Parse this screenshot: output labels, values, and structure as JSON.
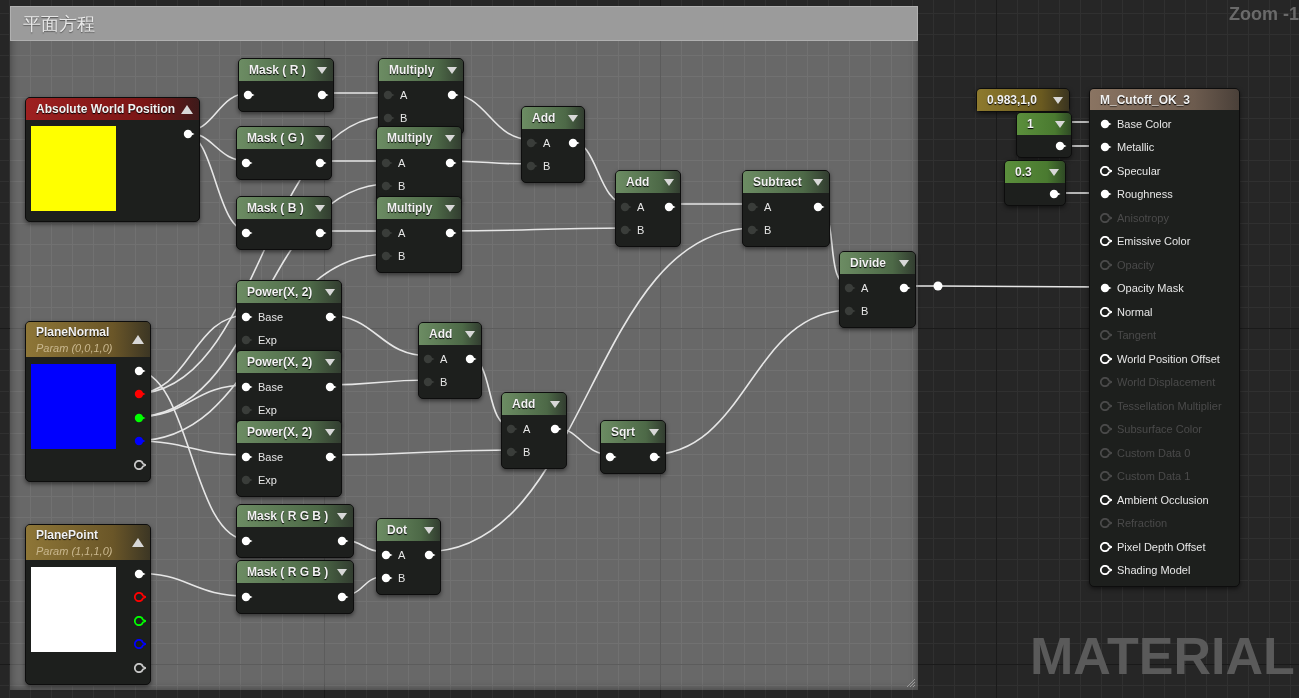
{
  "comment_box": {
    "title": "平面方程"
  },
  "zoom_label": "Zoom -1",
  "graph_type_label": "MATERIAL",
  "nodes": [
    {
      "kind": "input",
      "title": "Absolute World Position",
      "color": "#ffff00",
      "rows": [
        {
          "out": {
            "connected": true
          }
        }
      ]
    },
    {
      "kind": "expression",
      "title": "Mask ( R )",
      "rows": [
        {
          "in": {
            "connected": true
          },
          "out": {
            "connected": true
          }
        }
      ]
    },
    {
      "kind": "expression",
      "title": "Mask ( G )",
      "rows": [
        {
          "in": {
            "connected": true
          },
          "out": {
            "connected": true
          }
        }
      ]
    },
    {
      "kind": "expression",
      "title": "Mask ( B )",
      "rows": [
        {
          "in": {
            "connected": true
          },
          "out": {
            "connected": true
          }
        }
      ]
    },
    {
      "kind": "expression",
      "title": "Multiply",
      "rows": [
        {
          "in": {
            "label": "A",
            "connected": false
          },
          "out": {
            "connected": true
          }
        },
        {
          "in": {
            "label": "B",
            "connected": false
          }
        }
      ]
    },
    {
      "kind": "expression",
      "title": "Multiply",
      "rows": [
        {
          "in": {
            "label": "A",
            "connected": false
          },
          "out": {
            "connected": true
          }
        },
        {
          "in": {
            "label": "B",
            "connected": false
          }
        }
      ]
    },
    {
      "kind": "expression",
      "title": "Multiply",
      "rows": [
        {
          "in": {
            "label": "A",
            "connected": false
          },
          "out": {
            "connected": true
          }
        },
        {
          "in": {
            "label": "B",
            "connected": false
          }
        }
      ]
    },
    {
      "kind": "expression",
      "title": "Add",
      "rows": [
        {
          "in": {
            "label": "A",
            "connected": false
          },
          "out": {
            "connected": true
          }
        },
        {
          "in": {
            "label": "B",
            "connected": false
          }
        }
      ]
    },
    {
      "kind": "expression",
      "title": "Add",
      "rows": [
        {
          "in": {
            "label": "A",
            "connected": false
          },
          "out": {
            "connected": true
          }
        },
        {
          "in": {
            "label": "B",
            "connected": false
          }
        }
      ]
    },
    {
      "kind": "expression",
      "title": "Subtract",
      "rows": [
        {
          "in": {
            "label": "A",
            "connected": false
          },
          "out": {
            "connected": true
          }
        },
        {
          "in": {
            "label": "B",
            "connected": false
          }
        }
      ]
    },
    {
      "kind": "expression",
      "title": "Divide",
      "rows": [
        {
          "in": {
            "label": "A",
            "connected": false
          },
          "out": {
            "connected": true
          }
        },
        {
          "in": {
            "label": "B",
            "connected": false
          }
        }
      ]
    },
    {
      "kind": "expression",
      "title": "Power(X, 2)",
      "rows": [
        {
          "in": {
            "label": "Base",
            "connected": true
          },
          "out": {
            "connected": true
          }
        },
        {
          "in": {
            "label": "Exp",
            "connected": false
          }
        }
      ]
    },
    {
      "kind": "expression",
      "title": "Power(X, 2)",
      "rows": [
        {
          "in": {
            "label": "Base",
            "connected": true
          },
          "out": {
            "connected": true
          }
        },
        {
          "in": {
            "label": "Exp",
            "connected": false
          }
        }
      ]
    },
    {
      "kind": "expression",
      "title": "Power(X, 2)",
      "rows": [
        {
          "in": {
            "label": "Base",
            "connected": true
          },
          "out": {
            "connected": true
          }
        },
        {
          "in": {
            "label": "Exp",
            "connected": false
          }
        }
      ]
    },
    {
      "kind": "expression",
      "title": "Add",
      "rows": [
        {
          "in": {
            "label": "A",
            "connected": false
          },
          "out": {
            "connected": true
          }
        },
        {
          "in": {
            "label": "B",
            "connected": false
          }
        }
      ]
    },
    {
      "kind": "expression",
      "title": "Add",
      "rows": [
        {
          "in": {
            "label": "A",
            "connected": false
          },
          "out": {
            "connected": true
          }
        },
        {
          "in": {
            "label": "B",
            "connected": false
          }
        }
      ]
    },
    {
      "kind": "expression",
      "title": "Sqrt",
      "rows": [
        {
          "in": {
            "connected": true
          },
          "out": {
            "connected": true
          }
        }
      ]
    },
    {
      "kind": "expression",
      "title": "Mask ( R G B )",
      "rows": [
        {
          "in": {
            "connected": true
          },
          "out": {
            "connected": true
          }
        }
      ]
    },
    {
      "kind": "expression",
      "title": "Mask ( R G B )",
      "rows": [
        {
          "in": {
            "connected": true
          },
          "out": {
            "connected": true
          }
        }
      ]
    },
    {
      "kind": "expression",
      "title": "Dot",
      "rows": [
        {
          "in": {
            "label": "A",
            "connected": true
          },
          "out": {
            "connected": true
          }
        },
        {
          "in": {
            "label": "B",
            "connected": true
          }
        }
      ]
    },
    {
      "kind": "parameter",
      "title": "PlaneNormal",
      "subtitle": "Param (0,0,1,0)",
      "color": "#0000ff",
      "rows": [
        {
          "out": {
            "connected": true,
            "color": "#ffffff"
          }
        },
        {
          "out": {
            "connected": true,
            "color": "#ff0000"
          }
        },
        {
          "out": {
            "connected": true,
            "color": "#00ff00"
          }
        },
        {
          "out": {
            "connected": true,
            "color": "#0000ff"
          }
        },
        {
          "out": {
            "connected": false,
            "color": "#c8c8c8"
          }
        }
      ]
    },
    {
      "kind": "parameter",
      "title": "PlanePoint",
      "subtitle": "Param (1,1,1,0)",
      "color": "#ffffff",
      "rows": [
        {
          "out": {
            "connected": true,
            "color": "#ffffff"
          }
        },
        {
          "out": {
            "connected": false,
            "color": "#ff0000"
          }
        },
        {
          "out": {
            "connected": false,
            "color": "#00ff00"
          }
        },
        {
          "out": {
            "connected": false,
            "color": "#0000ff"
          }
        },
        {
          "out": {
            "connected": false,
            "color": "#c8c8c8"
          }
        }
      ]
    },
    {
      "kind": "vector_constant",
      "title": "0.983,1,0"
    },
    {
      "kind": "constant",
      "title": "1",
      "rows": [
        {
          "out": {
            "connected": true
          }
        }
      ]
    },
    {
      "kind": "constant",
      "title": "0.3",
      "rows": [
        {
          "out": {
            "connected": true
          }
        }
      ]
    },
    {
      "kind": "result",
      "title": "M_Cutoff_OK_3",
      "rows": [
        {
          "in": {
            "label": "Base Color",
            "connected": true,
            "disabled": false
          }
        },
        {
          "in": {
            "label": "Metallic",
            "connected": true,
            "disabled": false
          }
        },
        {
          "in": {
            "label": "Specular",
            "connected": false,
            "disabled": false
          }
        },
        {
          "in": {
            "label": "Roughness",
            "connected": true,
            "disabled": false
          }
        },
        {
          "in": {
            "label": "Anisotropy",
            "connected": false,
            "disabled": true
          }
        },
        {
          "in": {
            "label": "Emissive Color",
            "connected": false,
            "disabled": false
          }
        },
        {
          "in": {
            "label": "Opacity",
            "connected": false,
            "disabled": true
          }
        },
        {
          "in": {
            "label": "Opacity Mask",
            "connected": true,
            "disabled": false
          }
        },
        {
          "in": {
            "label": "Normal",
            "connected": false,
            "disabled": false
          }
        },
        {
          "in": {
            "label": "Tangent",
            "connected": false,
            "disabled": true
          }
        },
        {
          "in": {
            "label": "World Position Offset",
            "connected": false,
            "disabled": false
          }
        },
        {
          "in": {
            "label": "World Displacement",
            "connected": false,
            "disabled": true
          }
        },
        {
          "in": {
            "label": "Tessellation Multiplier",
            "connected": false,
            "disabled": true
          }
        },
        {
          "in": {
            "label": "Subsurface Color",
            "connected": false,
            "disabled": true
          }
        },
        {
          "in": {
            "label": "Custom Data 0",
            "connected": false,
            "disabled": true
          }
        },
        {
          "in": {
            "label": "Custom Data 1",
            "connected": false,
            "disabled": true
          }
        },
        {
          "in": {
            "label": "Ambient Occlusion",
            "connected": false,
            "disabled": false
          }
        },
        {
          "in": {
            "label": "Refraction",
            "connected": false,
            "disabled": true
          }
        },
        {
          "in": {
            "label": "Pixel Depth Offset",
            "connected": false,
            "disabled": false
          }
        },
        {
          "in": {
            "label": "Shading Model",
            "connected": false,
            "disabled": false
          }
        }
      ]
    }
  ]
}
